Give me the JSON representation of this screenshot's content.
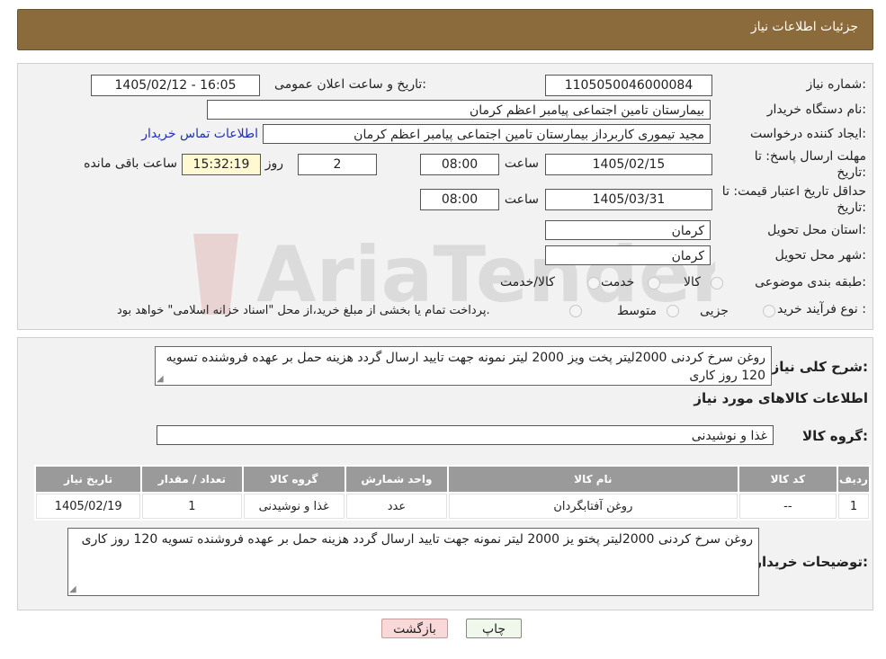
{
  "header": {
    "title": "جزئیات اطلاعات نیاز"
  },
  "form": {
    "need_number_label": "شماره نیاز:",
    "need_number": "1105050046000084",
    "announce_label": "تاریخ و ساعت اعلان عمومی:",
    "announce_value": "1405/02/12 - 16:05",
    "buyer_org_label": "نام دستگاه خریدار:",
    "buyer_org": "بیمارستان تامین اجتماعی پیامبر اعظم کرمان",
    "requester_label": "ایجاد کننده درخواست:",
    "requester": "مجید تیموری کاربرداز بیمارستان تامین اجتماعی پیامبر اعظم کرمان",
    "contact_link": "اطلاعات تماس خریدار",
    "deadline_label_1": "مهلت ارسال پاسخ: تا",
    "deadline_label_2": "تاریخ:",
    "deadline_date": "1405/02/15",
    "time_label": "ساعت",
    "deadline_time": "08:00",
    "days_value": "2",
    "days_label": "روز و",
    "remaining_time": "15:32:19",
    "remaining_label": "ساعت باقی مانده",
    "validity_label_1": "حداقل تاریخ اعتبار قیمت: تا",
    "validity_label_2": "تاریخ:",
    "validity_date": "1405/03/31",
    "validity_time_label": "ساعت",
    "validity_time": "08:00",
    "province_label": "استان محل تحویل:",
    "province": "کرمان",
    "city_label": "شهر محل تحویل:",
    "city": "کرمان",
    "category_label": "طبقه بندی موضوعی:",
    "category_options": [
      "کالا",
      "خدمت",
      "کالا/خدمت"
    ],
    "process_label": "نوع فرآیند خرید :",
    "process_options": [
      "جزیی",
      "متوسط"
    ],
    "process_note": "پرداخت تمام یا بخشی از مبلغ خرید،از محل \"اسناد خزانه اسلامی\" خواهد بود."
  },
  "description": {
    "label": "شرح کلی نیاز:",
    "text": "روغن سرخ کردنی 2000لیتر پخت ویز 2000 لیتر نمونه جهت تایید ارسال گردد هزینه حمل بر عهده فروشنده تسویه 120 روز کاری"
  },
  "goods": {
    "section_title": "اطلاعات کالاهای مورد نیاز",
    "group_label": "گروه کالا:",
    "group_value": "غذا و نوشیدنی",
    "columns": [
      "ردیف",
      "کد کالا",
      "نام کالا",
      "واحد شمارش",
      "گروه کالا",
      "تعداد / مقدار",
      "تاریخ نیاز"
    ],
    "rows": [
      [
        "1",
        "--",
        "روغن آفتابگردان",
        "عدد",
        "غذا و نوشیدنی",
        "1",
        "1405/02/19"
      ]
    ]
  },
  "buyer_notes": {
    "label": "توضیحات خریدار:",
    "text": "روغن سرخ کردنی 2000لیتر پختو یز 2000 لیتر نمونه جهت تایید ارسال گردد هزینه حمل بر عهده فروشنده تسویه 120 روز کاری"
  },
  "buttons": {
    "print": "چاپ",
    "back": "بازگشت"
  },
  "watermark": {
    "text": "AriaTender.neT"
  },
  "colors": {
    "header": "#8b6a3c",
    "table_header": "#9a9a9a",
    "link": "#2030c0",
    "back_button": "#f8d8d8"
  }
}
